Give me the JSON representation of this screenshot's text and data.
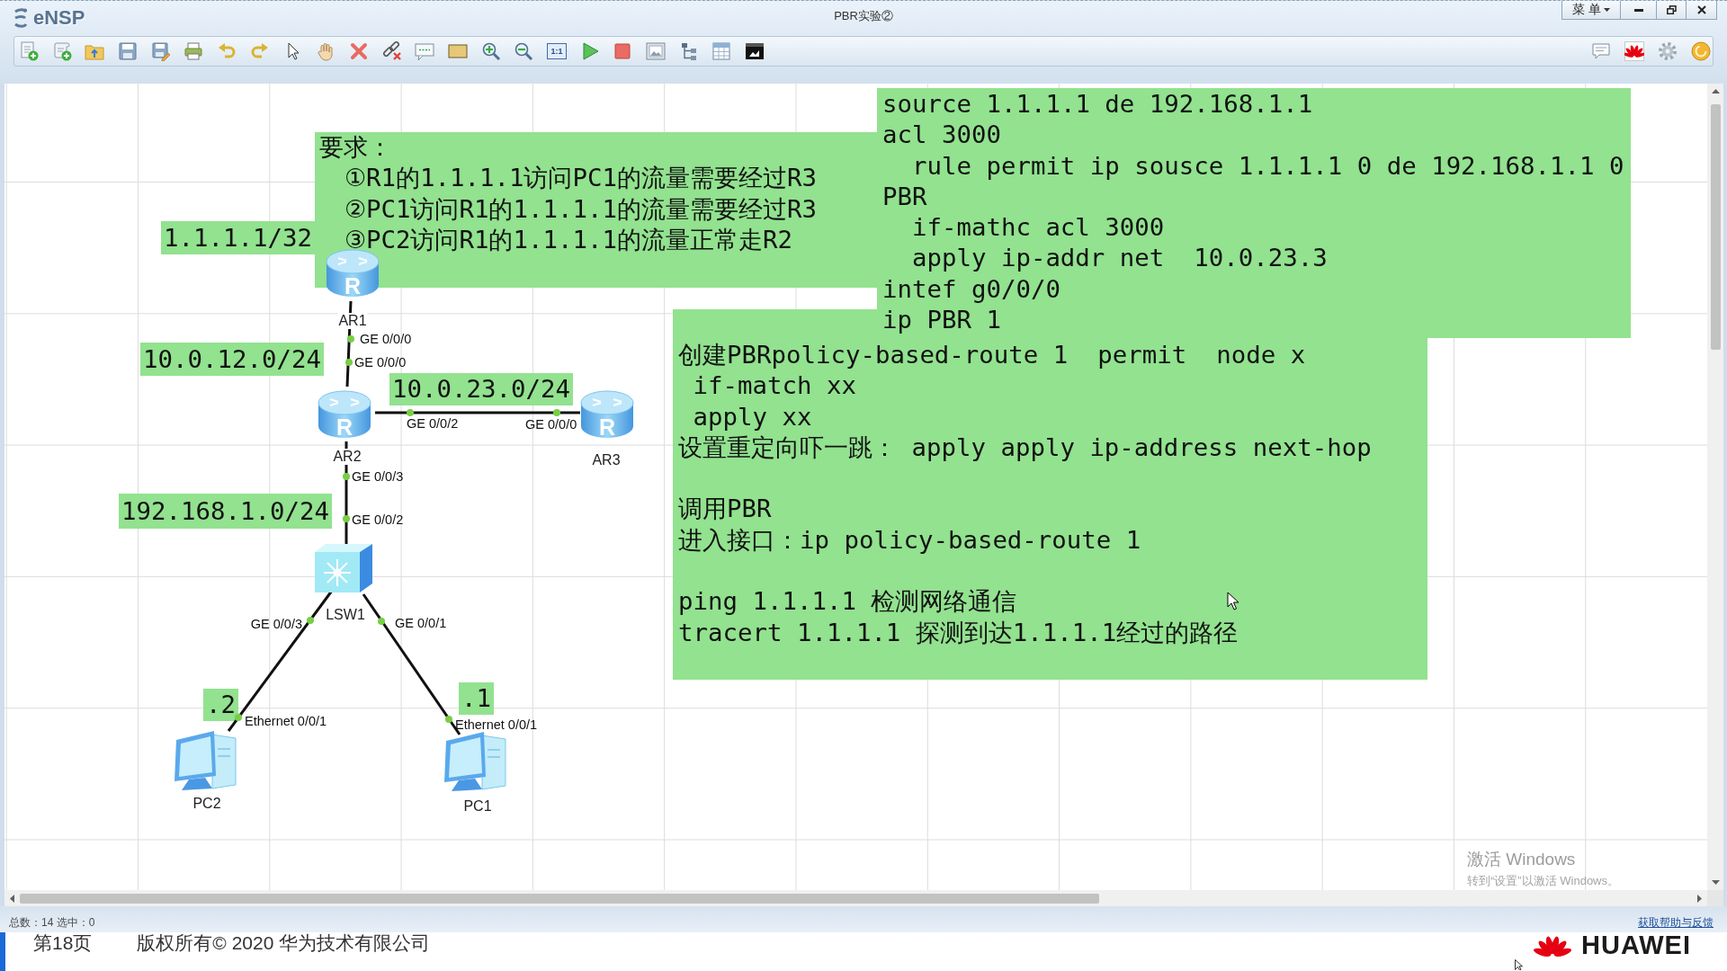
{
  "window": {
    "app_name": "eNSP",
    "title": "PBR实验②",
    "menu_label": "菜 单"
  },
  "toolbar": {
    "fit_label": "1:1"
  },
  "notes": {
    "requirements": {
      "title": "要求：",
      "items": [
        "①R1的1.1.1.1访问PC1的流量需要经过R3",
        "②PC1访问R1的1.1.1.1的流量需要经过R3",
        "③PC2访问R1的1.1.1.1的流量正常走R2"
      ]
    },
    "config": {
      "lines": [
        {
          "text": "source 1.1.1.1 de 192.168.1.1"
        },
        {
          "text": "acl 3000",
          "children": [
            {
              "text": "rule permit ip sousce 1.1.1.1 0 de 192.168.1.1 0"
            }
          ]
        },
        {
          "text": "PBR",
          "children": [
            {
              "text": "if-mathc acl 3000"
            },
            {
              "text": "apply ip-addr net  10.0.23.3"
            }
          ]
        },
        {
          "text": "intef g0/0/0"
        },
        {
          "text": "ip PBR 1"
        }
      ]
    },
    "steps": {
      "paragraphs": [
        [
          {
            "text": "创建PBRpolicy-based-route 1  permit  node x",
            "children": [
              {
                "text": "if-match xx"
              },
              {
                "text": "apply xx"
              }
            ]
          },
          {
            "text": "设置重定向吓一跳： apply apply ip-address next-hop"
          }
        ],
        [
          {
            "text": "调用PBR"
          },
          {
            "text": "进入接口：ip policy-based-route 1"
          }
        ],
        [
          {
            "text": "ping 1.1.1.1 检测网络通信"
          },
          {
            "text": "tracert 1.1.1.1 探测到达1.1.1.1经过的路径"
          }
        ]
      ]
    }
  },
  "topology": {
    "address_labels": [
      "1.1.1.1/32",
      "10.0.12.0/24",
      "10.0.23.0/24",
      "192.168.1.0/24",
      ".2",
      ".1"
    ],
    "devices": [
      {
        "name": "AR1",
        "kind": "router",
        "glyph": "R"
      },
      {
        "name": "AR2",
        "kind": "router",
        "glyph": "R"
      },
      {
        "name": "AR3",
        "kind": "router",
        "glyph": "R"
      },
      {
        "name": "LSW1",
        "kind": "switch"
      },
      {
        "name": "PC2",
        "kind": "pc"
      },
      {
        "name": "PC1",
        "kind": "pc"
      }
    ],
    "links": [
      {
        "ports": [
          "GE 0/0/0",
          "GE 0/0/0"
        ]
      },
      {
        "ports": [
          "GE 0/0/2",
          "GE 0/0/0"
        ]
      },
      {
        "ports": [
          "GE 0/0/3",
          "GE 0/0/2"
        ]
      },
      {
        "ports": [
          "GE 0/0/3",
          "Ethernet 0/0/1"
        ]
      },
      {
        "ports": [
          "GE 0/0/1",
          "Ethernet 0/0/1"
        ]
      }
    ]
  },
  "activation_notice": {
    "title": "激活 Windows",
    "hint": "转到“设置”以激活 Windows。"
  },
  "status_bar": {
    "summary": "总数：14 选中：0",
    "help_link": "获取帮助与反馈"
  },
  "slide_footer": {
    "page": "第18页",
    "copyright": "版权所有© 2020 华为技术有限公司",
    "brand": "HUAWEI"
  }
}
